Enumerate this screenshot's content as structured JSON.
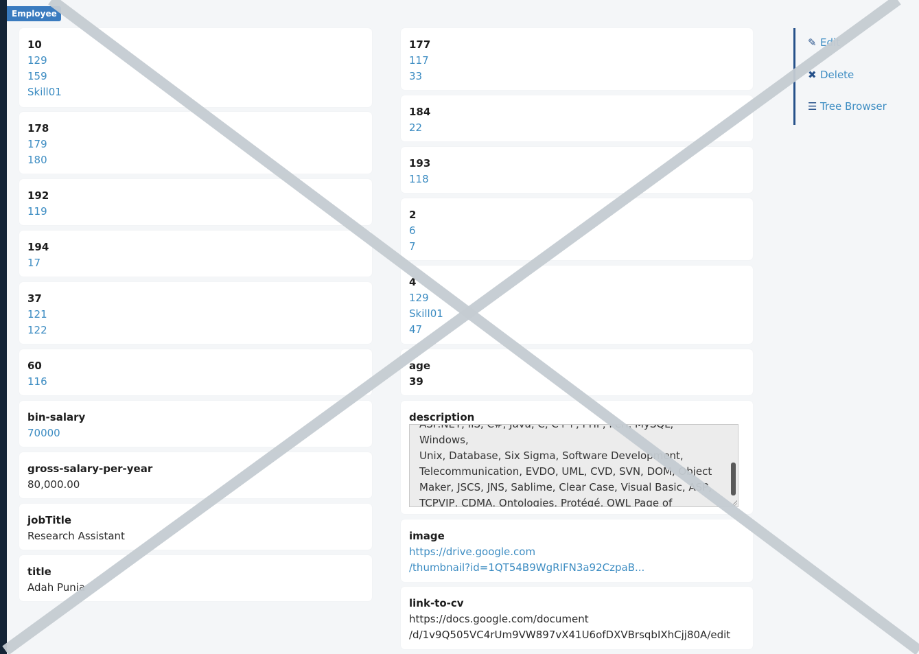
{
  "badge": "Employee",
  "left_column": [
    {
      "label": "10",
      "values": [
        "129",
        "159",
        "Skill01"
      ],
      "style": "link"
    },
    {
      "label": "178",
      "values": [
        "179",
        "180"
      ],
      "style": "link"
    },
    {
      "label": "192",
      "values": [
        "119"
      ],
      "style": "link"
    },
    {
      "label": "194",
      "values": [
        "17"
      ],
      "style": "link"
    },
    {
      "label": "37",
      "values": [
        "121",
        "122"
      ],
      "style": "link"
    },
    {
      "label": "60",
      "values": [
        "116"
      ],
      "style": "link"
    },
    {
      "label": "bin-salary",
      "values": [
        "70000"
      ],
      "style": "link"
    },
    {
      "label": "gross-salary-per-year",
      "values": [
        "80,000.00"
      ],
      "style": "plain"
    },
    {
      "label": "jobTitle",
      "values": [
        "Research Assistant"
      ],
      "style": "plain"
    },
    {
      "label": "title",
      "values": [
        "Adah Punia"
      ],
      "style": "plain"
    }
  ],
  "right_column": [
    {
      "label": "177",
      "values": [
        "117",
        "33"
      ],
      "style": "link"
    },
    {
      "label": "184",
      "values": [
        "22"
      ],
      "style": "link"
    },
    {
      "label": "193",
      "values": [
        "118"
      ],
      "style": "link"
    },
    {
      "label": "2",
      "values": [
        "6",
        "7"
      ],
      "style": "link"
    },
    {
      "label": "4",
      "values": [
        "129",
        "Skill01",
        "47"
      ],
      "style": "link"
    },
    {
      "label": "age",
      "values": [
        "39"
      ],
      "style": "bold"
    },
    {
      "label": "description",
      "description_lines": [
        "ASP.NET, IIS, C#, Java, C, C++, PHP, Perl, MySQL, Windows,",
        "Unix, Database, Six Sigma, Software Development,",
        "Telecommunication, EVDO, UML, CVD, SVN, DOM, Object",
        "Maker, JSCS, JNS, Sablime, Clear Case, Visual Basic, ASP,",
        "TCPVIP, CDMA, Ontologies, Protégé, OWL Page of"
      ]
    },
    {
      "label": "image",
      "values": [
        "https://drive.google.com",
        "/thumbnail?id=1QT54B9WgRIFN3a92CzpaB..."
      ],
      "style": "link"
    },
    {
      "label": "link-to-cv",
      "values": [
        "https://docs.google.com/document",
        "/d/1v9Q505VC4rUm9VW897vX41U6ofDXVBrsqbIXhCjj80A/edit"
      ],
      "style": "plain"
    }
  ],
  "actions": [
    {
      "icon": "pencil-icon",
      "glyph": "✎",
      "label": "Edit"
    },
    {
      "icon": "close-icon",
      "glyph": "✖",
      "label": "Delete"
    },
    {
      "icon": "list-icon",
      "glyph": "☰",
      "label": "Tree Browser"
    }
  ],
  "colors": {
    "link": "#3c8cc2",
    "sidebar": "#142436",
    "badge": "#3a7bbf",
    "overlay_x": "#c5ccd2"
  }
}
